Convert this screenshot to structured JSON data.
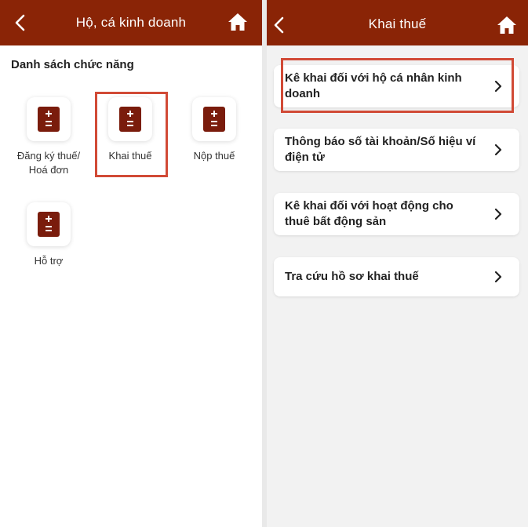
{
  "left": {
    "header": {
      "title": "Hộ, cá kinh doanh"
    },
    "section_title": "Danh sách chức năng",
    "functions": [
      {
        "label_line1": "Đăng ký thuế/",
        "label_line2": "Hoá đơn"
      },
      {
        "label_line1": "Khai thuế",
        "label_line2": ""
      },
      {
        "label_line1": "Nộp thuế",
        "label_line2": ""
      },
      {
        "label_line1": "Hỗ trợ",
        "label_line2": ""
      }
    ]
  },
  "right": {
    "header": {
      "title": "Khai thuế"
    },
    "items": [
      {
        "label": "Kê khai đối với hộ cá nhân kinh doanh"
      },
      {
        "label": "Thông báo số tài khoản/Số hiệu ví điện tử"
      },
      {
        "label": "Kê khai đối với hoạt động cho thuê bất động sản"
      },
      {
        "label": "Tra cứu hồ sơ khai thuế"
      }
    ]
  },
  "colors": {
    "header_bg": "#8a2406",
    "icon_bg": "#7a1c0c",
    "highlight": "#d14a36"
  },
  "icons": {
    "back": "chevron-left-icon",
    "home": "home-icon",
    "function": "calculator-icon",
    "item": "chevron-right-icon"
  }
}
